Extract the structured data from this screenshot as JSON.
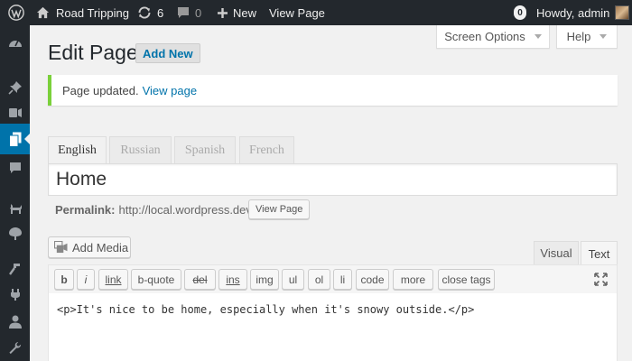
{
  "admin_bar": {
    "site_name": "Road Tripping",
    "updates_count": "6",
    "comments_count": "0",
    "new_label": "New",
    "view_page_label": "View Page",
    "notifications_count": "0",
    "howdy": "Howdy, admin"
  },
  "screen_meta": {
    "screen_options_label": "Screen Options",
    "help_label": "Help"
  },
  "page": {
    "title": "Edit Page",
    "add_new_label": "Add New"
  },
  "notice": {
    "message": "Page updated.",
    "link_text": "View page"
  },
  "languages": [
    {
      "label": "English"
    },
    {
      "label": "Russian"
    },
    {
      "label": "Spanish"
    },
    {
      "label": "French"
    }
  ],
  "post": {
    "title": "Home",
    "permalink_label": "Permalink:",
    "permalink_url": "http://local.wordpress.dev/",
    "view_page_button": "View Page"
  },
  "editor": {
    "add_media_label": "Add Media",
    "tabs": [
      {
        "label": "Visual"
      },
      {
        "label": "Text"
      }
    ],
    "quicktags": [
      {
        "label": "b"
      },
      {
        "label": "i"
      },
      {
        "label": "link"
      },
      {
        "label": "b-quote"
      },
      {
        "label": "del"
      },
      {
        "label": "ins"
      },
      {
        "label": "img"
      },
      {
        "label": "ul"
      },
      {
        "label": "ol"
      },
      {
        "label": "li"
      },
      {
        "label": "code"
      },
      {
        "label": "more"
      },
      {
        "label": "close tags"
      }
    ],
    "content": "<p>It's nice to be home, especially when it's snowy outside.</p>"
  },
  "colors": {
    "admin_bar_bg": "#23282d",
    "accent_blue": "#0073aa",
    "notice_green": "#7ad03a"
  }
}
